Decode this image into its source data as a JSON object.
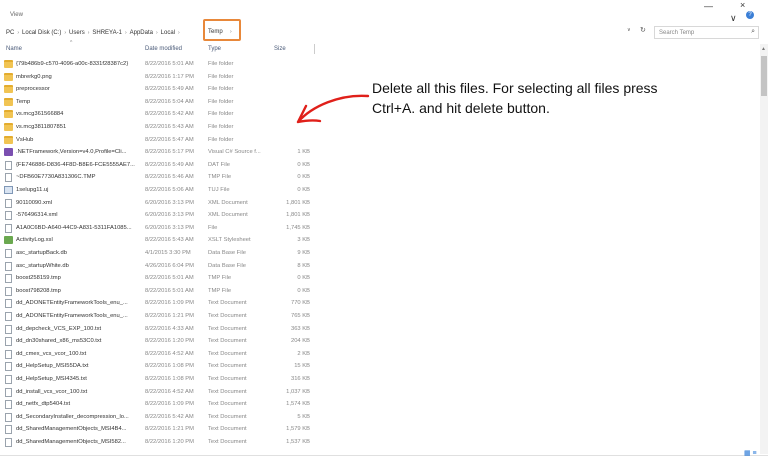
{
  "ribbon": {
    "view_tab": "View"
  },
  "address": {
    "crumbs": [
      "PC",
      "Local Disk (C:)",
      "Users",
      "SHREYA-1",
      "AppData",
      "Local"
    ],
    "active": "Temp"
  },
  "search": {
    "placeholder": "Search Temp"
  },
  "columns": {
    "name": "Name",
    "date": "Date modified",
    "type": "Type",
    "size": "Size"
  },
  "files": [
    {
      "icon": "folder-icon",
      "name": "{79b486b9-c570-4096-a00c-8331f28387c2}",
      "date": "8/22/2016 5:01 AM",
      "type": "File folder",
      "size": ""
    },
    {
      "icon": "folder-icon",
      "name": "mbrerkg0.png",
      "date": "8/22/2016 1:17 PM",
      "type": "File folder",
      "size": ""
    },
    {
      "icon": "folder-icon",
      "name": "preprocessor",
      "date": "8/22/2016 5:49 AM",
      "type": "File folder",
      "size": ""
    },
    {
      "icon": "folder-icon",
      "name": "Temp",
      "date": "8/22/2016 5:04 AM",
      "type": "File folder",
      "size": ""
    },
    {
      "icon": "folder-icon",
      "name": "vs.mcg361566884",
      "date": "8/22/2016 5:42 AM",
      "type": "File folder",
      "size": ""
    },
    {
      "icon": "folder-icon",
      "name": "vs.mcg3811807851",
      "date": "8/22/2016 5:43 AM",
      "type": "File folder",
      "size": ""
    },
    {
      "icon": "folder-icon",
      "name": "VsHub",
      "date": "8/22/2016 5:47 AM",
      "type": "File folder",
      "size": ""
    },
    {
      "icon": "cs-file-icon",
      "name": ".NETFramework,Version=v4.0,Profile=Cli...",
      "date": "8/22/2016 5:17 PM",
      "type": "Visual C# Source f...",
      "size": "1 KB"
    },
    {
      "icon": "file-icon",
      "name": "{FE746886-D836-4F8D-B8E6-FCE5555AE7...",
      "date": "8/22/2016 5:49 AM",
      "type": "DAT File",
      "size": "0 KB"
    },
    {
      "icon": "file-icon",
      "name": "~DFB60E7730A831306C.TMP",
      "date": "8/22/2016 5:46 AM",
      "type": "TMP File",
      "size": "0 KB"
    },
    {
      "icon": "image-file-icon",
      "name": "1selupg11.uj",
      "date": "8/22/2016 5:06 AM",
      "type": "TUJ File",
      "size": "0 KB"
    },
    {
      "icon": "file-icon",
      "name": "90110090.xml",
      "date": "6/20/2016 3:13 PM",
      "type": "XML Document",
      "size": "1,801 KB"
    },
    {
      "icon": "file-icon",
      "name": "-576496314.xml",
      "date": "6/20/2016 3:13 PM",
      "type": "XML Document",
      "size": "1,801 KB"
    },
    {
      "icon": "file-icon",
      "name": "A1A0C6BD-A640-44C9-A831-5311FA1085...",
      "date": "6/20/2016 3:13 PM",
      "type": "File",
      "size": "1,745 KB"
    },
    {
      "icon": "xslt-file-icon",
      "name": "ActivityLog.xsl",
      "date": "8/22/2016 5:43 AM",
      "type": "XSLT Stylesheet",
      "size": "3 KB"
    },
    {
      "icon": "file-icon",
      "name": "asc_startupBack.db",
      "date": "4/1/2015 3:30 PM",
      "type": "Data Base File",
      "size": "9 KB"
    },
    {
      "icon": "file-icon",
      "name": "asc_startupWhite.db",
      "date": "4/26/2016 6:04 PM",
      "type": "Data Base File",
      "size": "8 KB"
    },
    {
      "icon": "file-icon",
      "name": "boost258159.tmp",
      "date": "8/22/2016 5:01 AM",
      "type": "TMP File",
      "size": "0 KB"
    },
    {
      "icon": "file-icon",
      "name": "boost798208.tmp",
      "date": "8/22/2016 5:01 AM",
      "type": "TMP File",
      "size": "0 KB"
    },
    {
      "icon": "file-icon",
      "name": "dd_ADONETEntityFrameworkTools_enu_...",
      "date": "8/22/2016 1:09 PM",
      "type": "Text Document",
      "size": "770 KB"
    },
    {
      "icon": "file-icon",
      "name": "dd_ADONETEntityFrameworkTools_enu_...",
      "date": "8/22/2016 1:21 PM",
      "type": "Text Document",
      "size": "765 KB"
    },
    {
      "icon": "file-icon",
      "name": "dd_depcheck_VCS_EXP_100.txt",
      "date": "8/22/2016 4:33 AM",
      "type": "Text Document",
      "size": "363 KB"
    },
    {
      "icon": "file-icon",
      "name": "dd_dn30shared_x86_ms53C0.txt",
      "date": "8/22/2016 1:20 PM",
      "type": "Text Document",
      "size": "204 KB"
    },
    {
      "icon": "file-icon",
      "name": "dd_cmex_vcs_vcor_100.txt",
      "date": "8/22/2016 4:52 AM",
      "type": "Text Document",
      "size": "2 KB"
    },
    {
      "icon": "file-icon",
      "name": "dd_HelpSetup_MSI55DA.txt",
      "date": "8/22/2016 1:08 PM",
      "type": "Text Document",
      "size": "15 KB"
    },
    {
      "icon": "file-icon",
      "name": "dd_HelpSetup_MSI4345.txt",
      "date": "8/22/2016 1:08 PM",
      "type": "Text Document",
      "size": "316 KB"
    },
    {
      "icon": "file-icon",
      "name": "dd_install_vcs_vcor_100.txt",
      "date": "8/22/2016 4:52 AM",
      "type": "Text Document",
      "size": "1,037 KB"
    },
    {
      "icon": "file-icon",
      "name": "dd_netfx_dtp5404.txt",
      "date": "8/22/2016 1:09 PM",
      "type": "Text Document",
      "size": "1,574 KB"
    },
    {
      "icon": "file-icon",
      "name": "dd_SecondaryInstaller_decompression_lo...",
      "date": "8/22/2016 5:42 AM",
      "type": "Text Document",
      "size": "5 KB"
    },
    {
      "icon": "file-icon",
      "name": "dd_SharedManagementObjects_MSI4B4...",
      "date": "8/22/2016 1:21 PM",
      "type": "Text Document",
      "size": "1,579 KB"
    },
    {
      "icon": "file-icon",
      "name": "dd_SharedManagementObjects_MSI582...",
      "date": "8/22/2016 1:20 PM",
      "type": "Text Document",
      "size": "1,537 KB"
    }
  ],
  "annotation": {
    "text": "Delete all this files. For selecting all files press Ctrl+A. and hit delete button.",
    "color": "#e0201a"
  }
}
